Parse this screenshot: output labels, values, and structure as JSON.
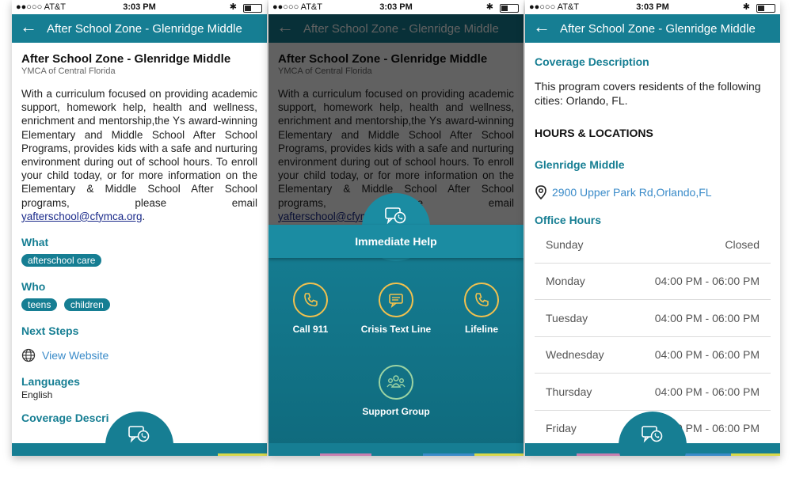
{
  "status": {
    "carrier": "●●○○○ AT&T",
    "time": "3:03 PM"
  },
  "colors": {
    "accent": "#167e93",
    "link": "#3a8bc9",
    "chip": "#167e93"
  },
  "appbar_title": "After School Zone - Glenridge Middle",
  "detail": {
    "title": "After School Zone - Glenridge Middle",
    "org": "YMCA of Central Florida",
    "description": "With a curriculum focused on providing academic support, homework help, health and wellness, enrichment and mentorship,the Ys award-winning Elementary and Middle School After School Programs, provides kids with a safe and nurturing environment during out of school hours. To enroll your child today, or for more information on the Elementary & Middle School After School programs, please email ",
    "email": "yafterschool@cfymca.org",
    "email_suffix": ".",
    "what_label": "What",
    "what_chips": [
      "afterschool care"
    ],
    "who_label": "Who",
    "who_chips": [
      "teens",
      "children"
    ],
    "next_steps_label": "Next Steps",
    "website_label": "View Website",
    "languages_label": "Languages",
    "languages_value": "English",
    "coverage_partial": "Coverage Descri"
  },
  "help": {
    "title": "Immediate Help",
    "options": [
      {
        "label": "Call 911",
        "icon": "phone-icon"
      },
      {
        "label": "Crisis Text Line",
        "icon": "message-icon"
      },
      {
        "label": "Lifeline",
        "icon": "phone-icon"
      },
      {
        "label": "Support Group",
        "icon": "group-icon"
      }
    ]
  },
  "coverage": {
    "title": "Coverage Description",
    "text": "This program covers residents of the following cities: Orlando, FL.",
    "hours_locations": "HOURS & LOCATIONS",
    "location_name": "Glenridge Middle",
    "address": "2900 Upper Park Rd,Orlando,FL",
    "office_hours": "Office Hours",
    "hours": [
      {
        "day": "Sunday",
        "time": "Closed"
      },
      {
        "day": "Monday",
        "time": "04:00 PM - 06:00 PM"
      },
      {
        "day": "Tuesday",
        "time": "04:00 PM - 06:00 PM"
      },
      {
        "day": "Wednesday",
        "time": "04:00 PM - 06:00 PM"
      },
      {
        "day": "Thursday",
        "time": "04:00 PM - 06:00 PM"
      },
      {
        "day": "Friday",
        "time": "04:00 PM - 06:00 PM"
      }
    ]
  }
}
